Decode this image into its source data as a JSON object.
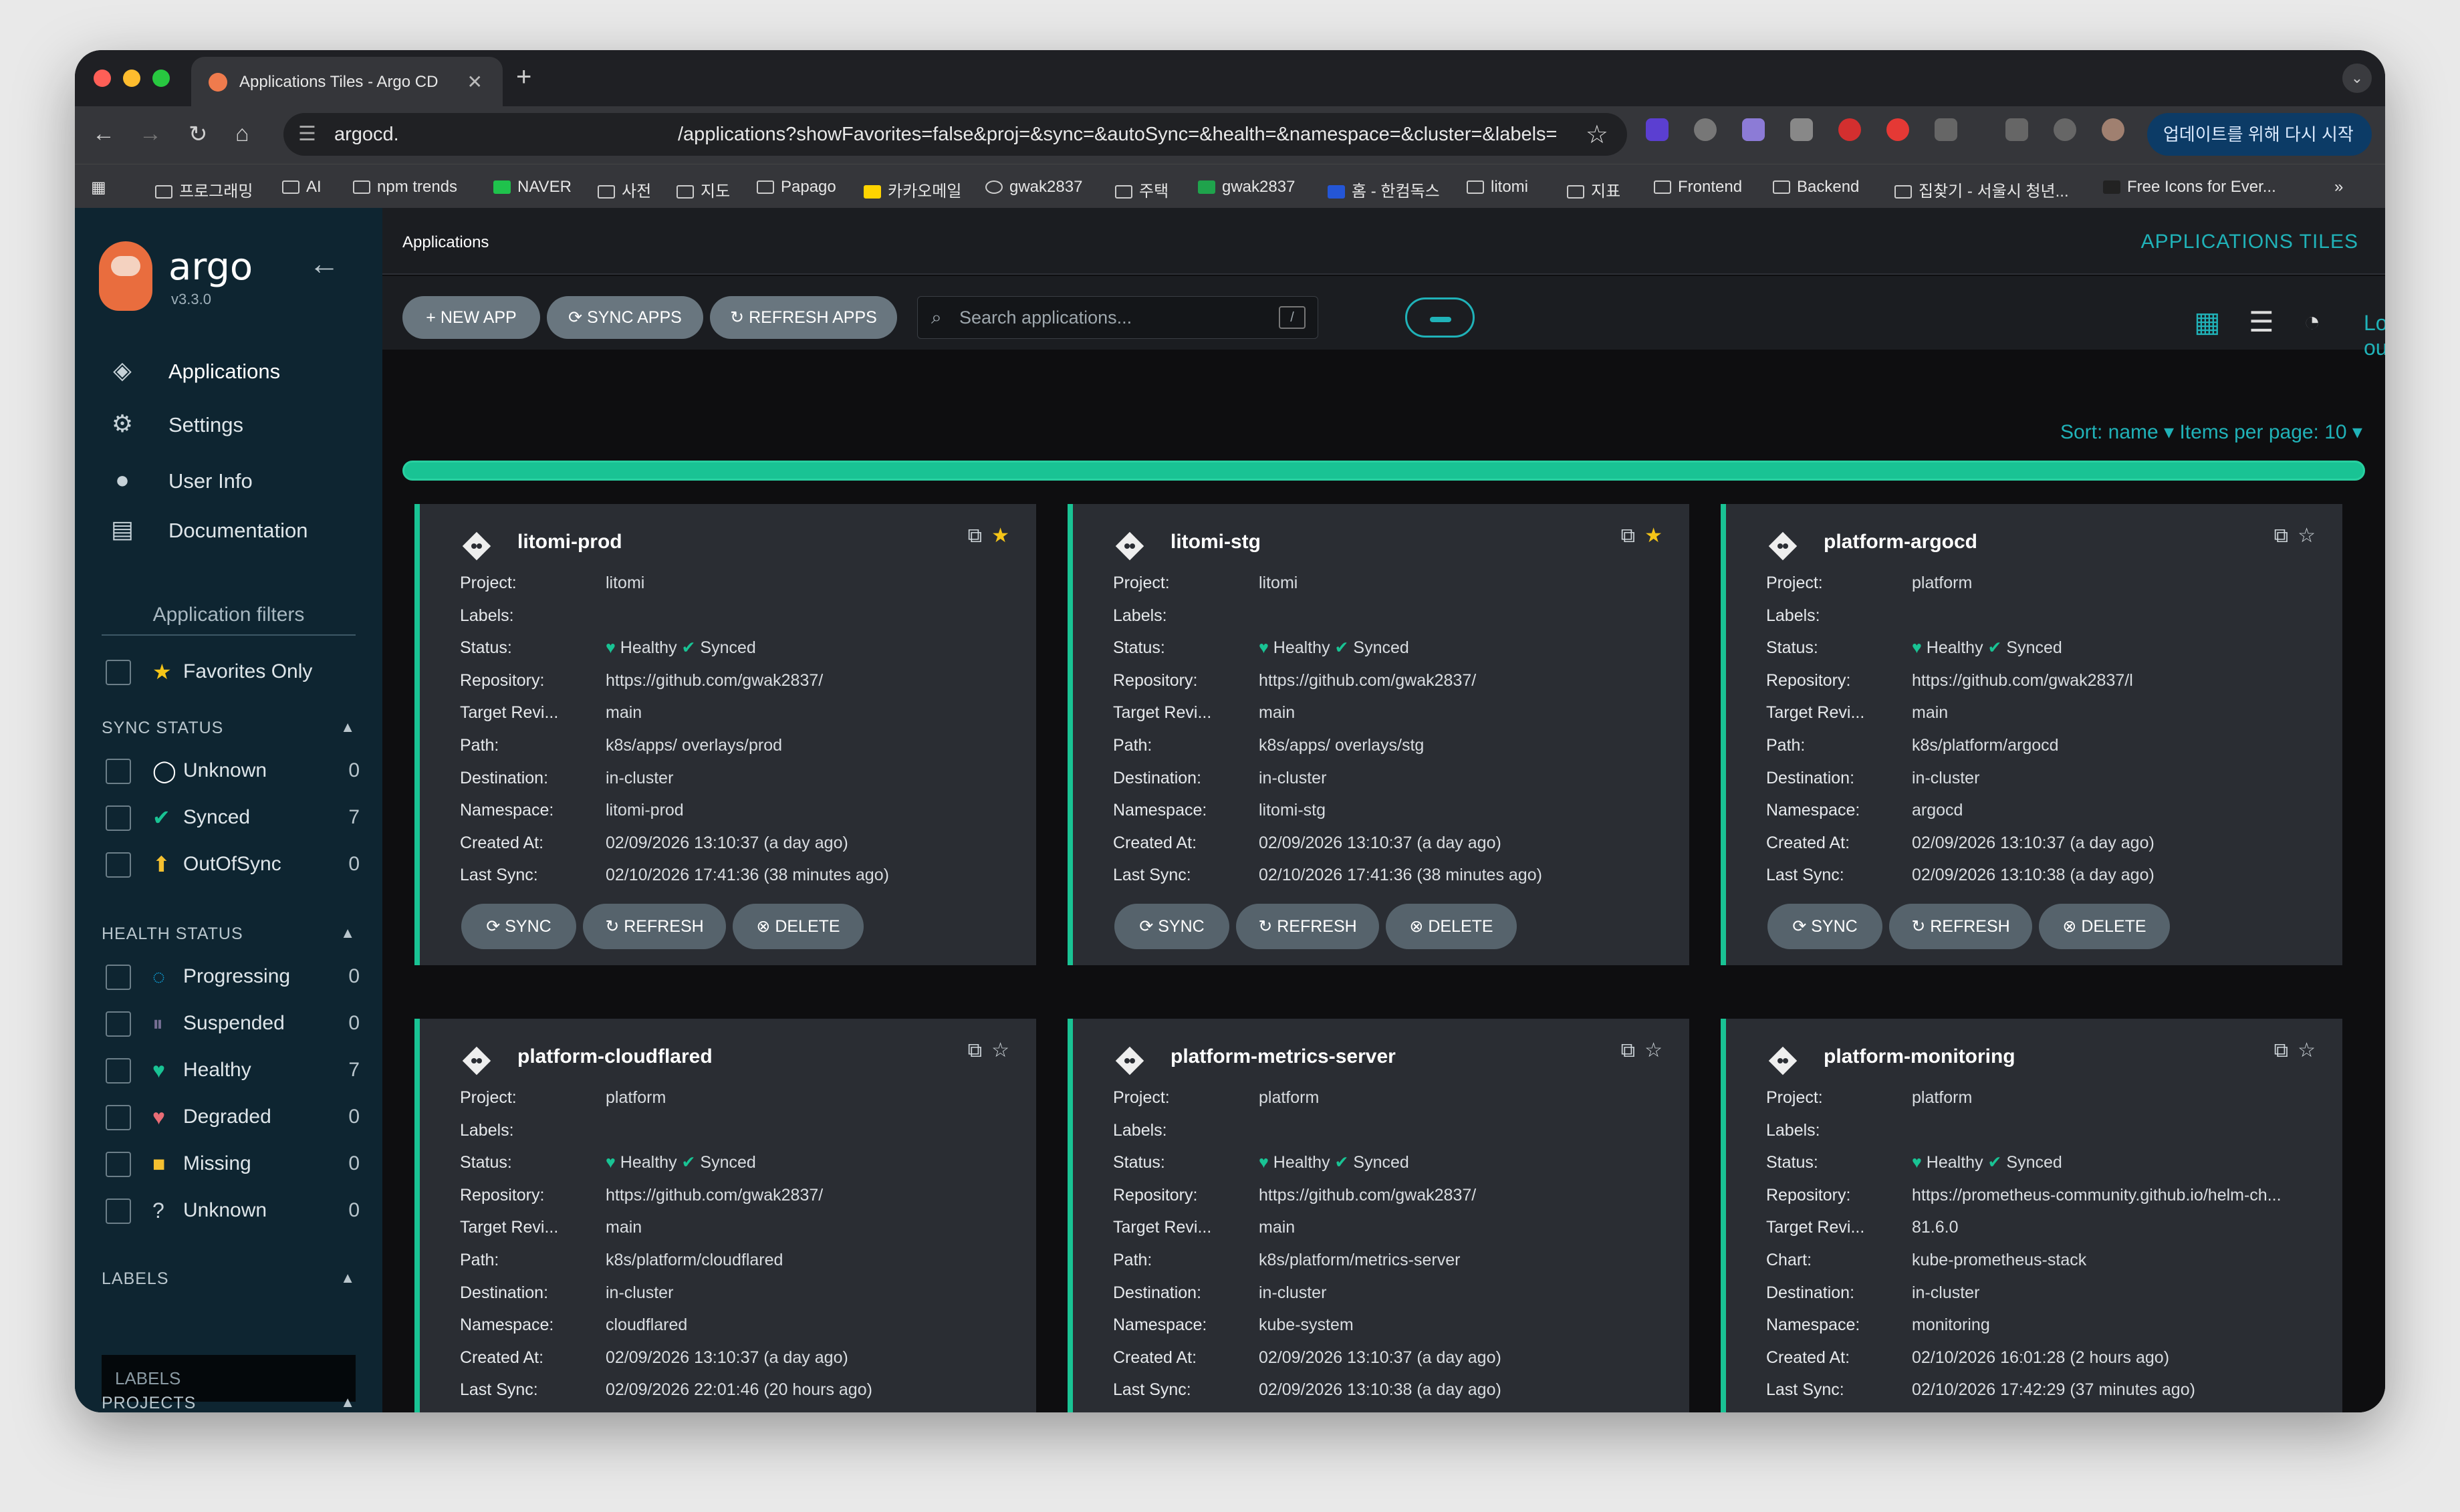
{
  "browser": {
    "tab_title": "Applications Tiles - Argo CD",
    "url_host": "argocd.",
    "url_path": "/applications?showFavorites=false&proj=&sync=&autoSync=&health=&namespace=&cluster=&labels=",
    "update_label": "업데이트를 위해 다시 시작",
    "bookmarks": [
      "프로그래밍",
      "AI",
      "npm trends",
      "NAVER",
      "사전",
      "지도",
      "Papago",
      "카카오메일",
      "gwak2837",
      "주택",
      "gwak2837",
      "홈 - 한컴독스",
      "litomi",
      "지표",
      "Frontend",
      "Backend",
      "집찾기 - 서울시 청년...",
      "Free Icons for Ever..."
    ]
  },
  "sidebar": {
    "brand": "argo",
    "version": "v3.3.0",
    "nav": [
      {
        "label": "Applications",
        "icon": "layers-icon"
      },
      {
        "label": "Settings",
        "icon": "gear-icon"
      },
      {
        "label": "User Info",
        "icon": "user-icon"
      },
      {
        "label": "Documentation",
        "icon": "book-icon"
      }
    ],
    "filters_title": "Application filters",
    "favorites_label": "Favorites Only",
    "sync_title": "SYNC STATUS",
    "sync": [
      {
        "label": "Unknown",
        "count": "0",
        "icon": "circle-notch-icon"
      },
      {
        "label": "Synced",
        "count": "7",
        "icon": "check-circle-icon"
      },
      {
        "label": "OutOfSync",
        "count": "0",
        "icon": "arrow-up-circle-icon"
      }
    ],
    "health_title": "HEALTH STATUS",
    "health": [
      {
        "label": "Progressing",
        "count": "0",
        "icon": "spinner-icon"
      },
      {
        "label": "Suspended",
        "count": "0",
        "icon": "pause-circle-icon"
      },
      {
        "label": "Healthy",
        "count": "7",
        "icon": "heart-icon"
      },
      {
        "label": "Degraded",
        "count": "0",
        "icon": "broken-heart-icon"
      },
      {
        "label": "Missing",
        "count": "0",
        "icon": "ghost-icon"
      },
      {
        "label": "Unknown",
        "count": "0",
        "icon": "question-circle-icon"
      }
    ],
    "labels_title": "LABELS",
    "labels_placeholder": "LABELS",
    "projects_title": "PROJECTS"
  },
  "topbar": {
    "breadcrumb": "Applications",
    "title": "APPLICATIONS TILES"
  },
  "toolbar": {
    "new_app": "NEW APP",
    "sync_apps": "SYNC APPS",
    "refresh_apps": "REFRESH APPS",
    "search_placeholder": "Search applications...",
    "search_shortcut": "/",
    "logout": "Log out"
  },
  "sort": {
    "text": "Sort: name ▾ Items per page: 10 ▾"
  },
  "labels": {
    "project": "Project:",
    "labels": "Labels:",
    "status": "Status:",
    "repository": "Repository:",
    "target": "Target Revi...",
    "path": "Path:",
    "chart": "Chart:",
    "destination": "Destination:",
    "namespace": "Namespace:",
    "created": "Created At:",
    "lastsync": "Last Sync:",
    "health": "Healthy",
    "sync": "Synced",
    "btn_sync": "SYNC",
    "btn_refresh": "REFRESH",
    "btn_delete": "DELETE"
  },
  "apps": [
    {
      "name": "litomi-prod",
      "project": "litomi",
      "repo": "https://github.com/gwak2837/",
      "target": "main",
      "path": "k8s/apps/         overlays/prod",
      "destination": "in-cluster",
      "namespace": "litomi-prod",
      "created": "02/09/2026 13:10:37  (a day ago)",
      "lastsync": "02/10/2026 17:41:36  (38 minutes ago)"
    },
    {
      "name": "litomi-stg",
      "project": "litomi",
      "repo": "https://github.com/gwak2837/",
      "target": "main",
      "path": "k8s/apps/         overlays/stg",
      "destination": "in-cluster",
      "namespace": "litomi-stg",
      "created": "02/09/2026 13:10:37  (a day ago)",
      "lastsync": "02/10/2026 17:41:36  (38 minutes ago)"
    },
    {
      "name": "platform-argocd",
      "project": "platform",
      "repo": "https://github.com/gwak2837/l",
      "target": "main",
      "path": "k8s/platform/argocd",
      "destination": "in-cluster",
      "namespace": "argocd",
      "created": "02/09/2026 13:10:37  (a day ago)",
      "lastsync": "02/09/2026 13:10:38  (a day ago)"
    },
    {
      "name": "platform-cloudflared",
      "project": "platform",
      "repo": "https://github.com/gwak2837/",
      "target": "main",
      "path": "k8s/platform/cloudflared",
      "destination": "in-cluster",
      "namespace": "cloudflared",
      "created": "02/09/2026 13:10:37  (a day ago)",
      "lastsync": "02/09/2026 22:01:46  (20 hours ago)"
    },
    {
      "name": "platform-metrics-server",
      "project": "platform",
      "repo": "https://github.com/gwak2837/",
      "target": "main",
      "path": "k8s/platform/metrics-server",
      "destination": "in-cluster",
      "namespace": "kube-system",
      "created": "02/09/2026 13:10:37  (a day ago)",
      "lastsync": "02/09/2026 13:10:38  (a day ago)"
    },
    {
      "name": "platform-monitoring",
      "project": "platform",
      "repo": "https://prometheus-community.github.io/helm-ch...",
      "target": "81.6.0",
      "chart": "kube-prometheus-stack",
      "destination": "in-cluster",
      "namespace": "monitoring",
      "created": "02/10/2026 16:01:28  (2 hours ago)",
      "lastsync": "02/10/2026 17:42:29  (37 minutes ago)"
    }
  ]
}
